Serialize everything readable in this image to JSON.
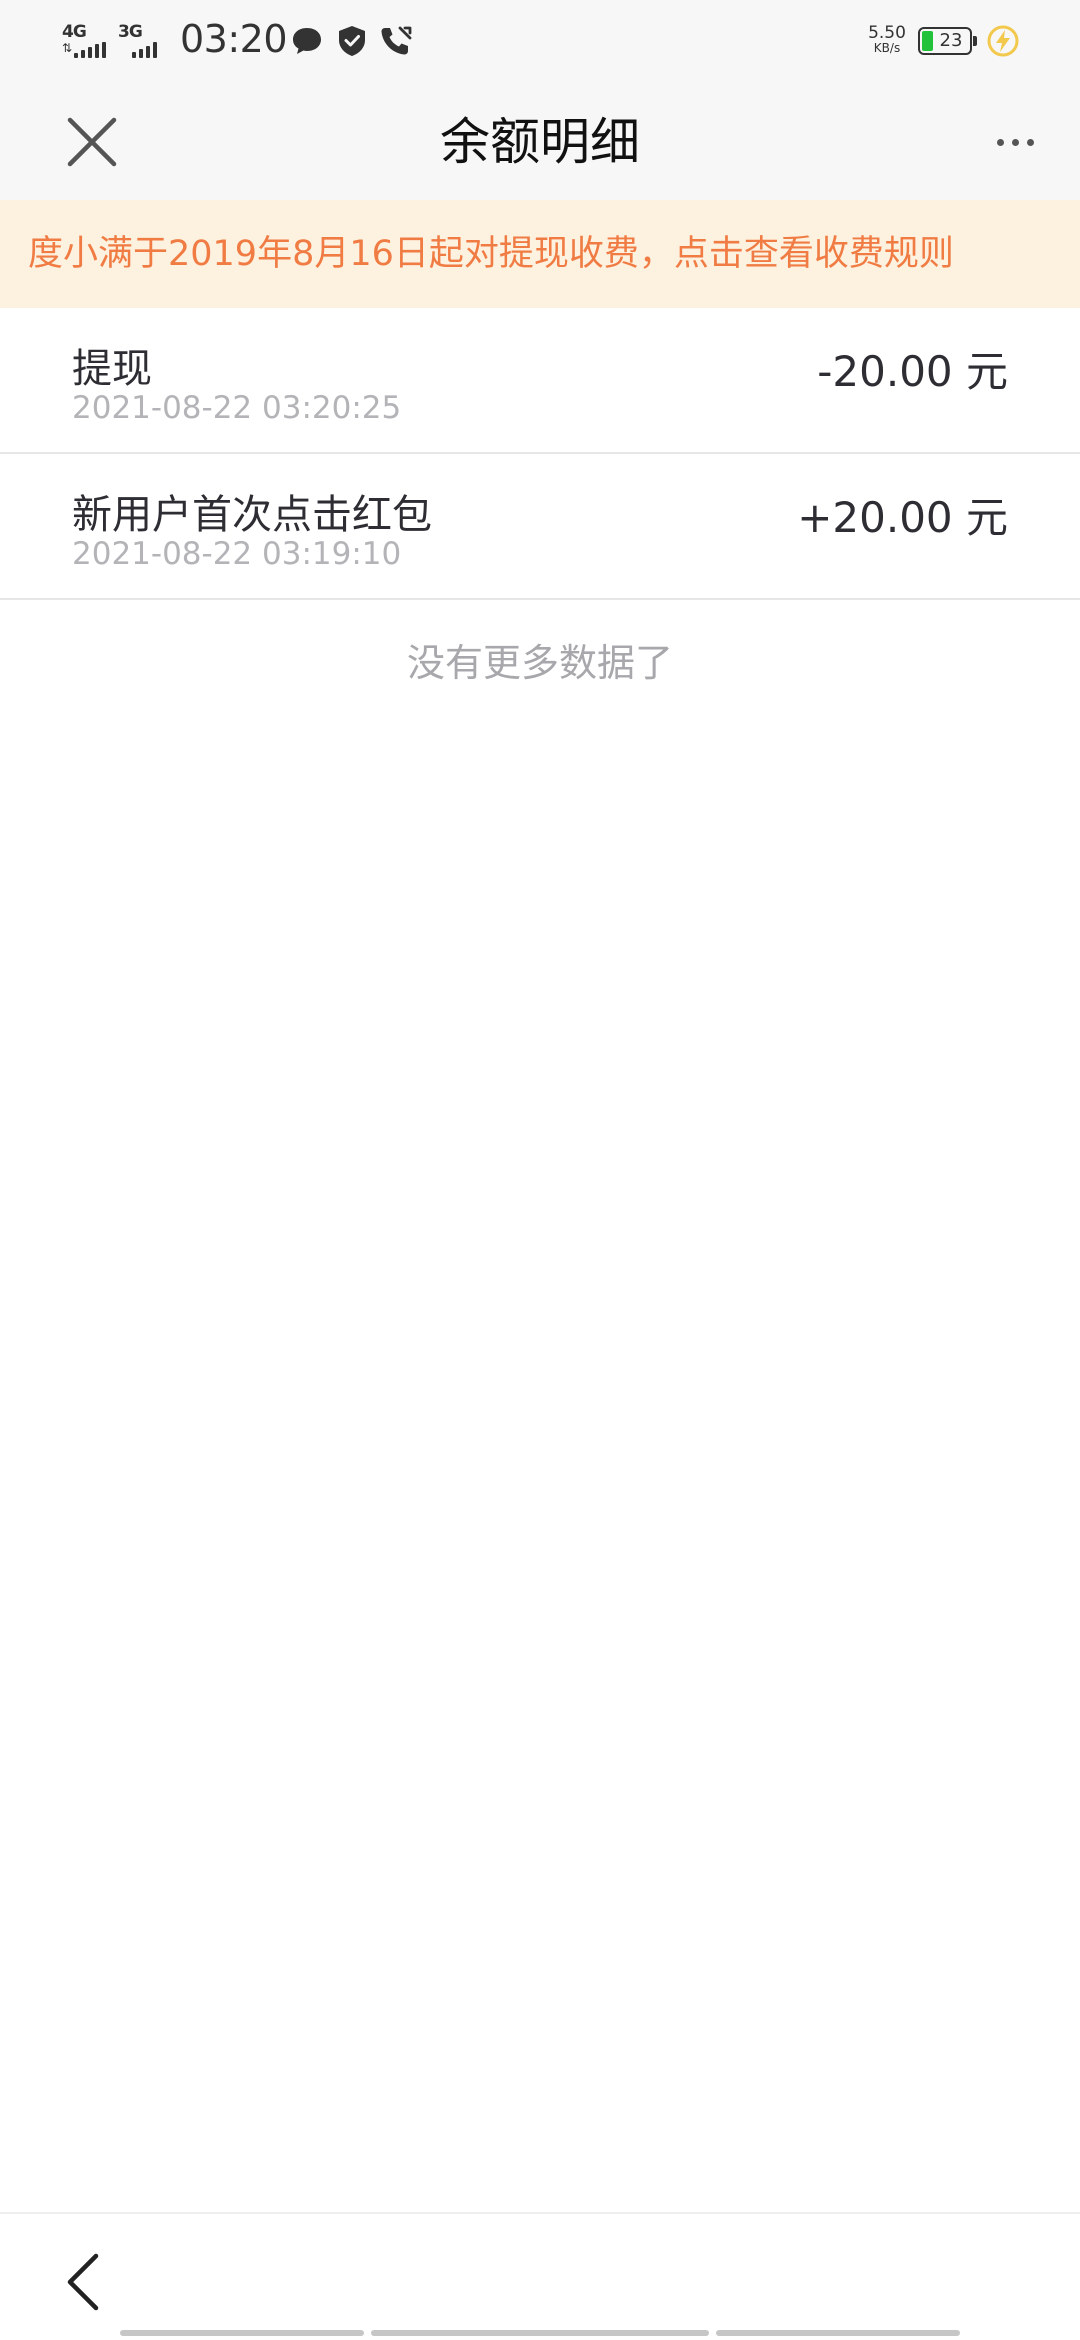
{
  "status_bar": {
    "network1": "4G",
    "network2": "3G",
    "time": "03:20",
    "speed_value": "5.50",
    "speed_unit": "KB/s",
    "battery_level": "23",
    "battery_color": "#22c33a",
    "icons": [
      "message-icon",
      "shield-icon",
      "phone-icon",
      "charging-icon"
    ]
  },
  "header": {
    "title": "余额明细",
    "close_icon": "close-icon",
    "more_icon": "more-icon"
  },
  "notice": {
    "text": "度小满于2019年8月16日起对提现收费，点击查看收费规则",
    "color": "#f07c44",
    "background": "#fdf1df"
  },
  "records": [
    {
      "title": "提现",
      "time": "2021-08-22 03:20:25",
      "amount": "-20.00 元"
    },
    {
      "title": "新用户首次点击红包",
      "time": "2021-08-22 03:19:10",
      "amount": "+20.00 元"
    }
  ],
  "no_more_text": "没有更多数据了",
  "bottom_bar": {
    "back_icon": "back-chevron-icon"
  }
}
